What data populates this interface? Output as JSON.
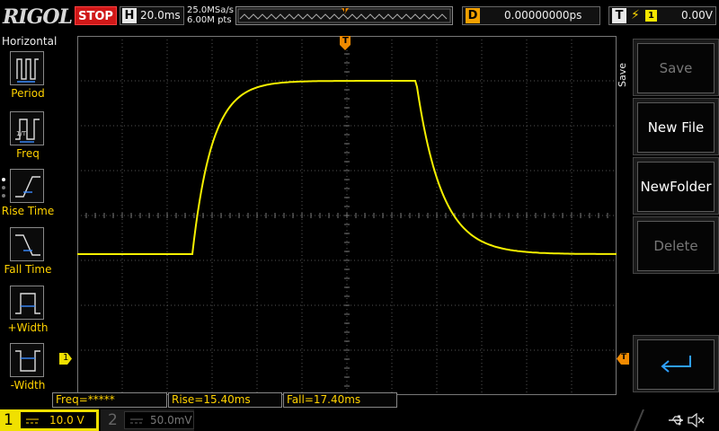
{
  "topbar": {
    "logo": "RIGOL",
    "run_state": "STOP",
    "horizontal": {
      "label": "H",
      "value": "20.0ms"
    },
    "sample_rate": "25.0MSa/s",
    "memory_depth": "6.00M pts",
    "trigger_position_marker": "T",
    "delay": {
      "label": "D",
      "value": "0.00000000ps"
    },
    "trigger": {
      "label": "T",
      "edge": "rising-edge-icon",
      "source": "1",
      "level": "0.00V"
    }
  },
  "left_menu": {
    "title": "Horizontal",
    "items": [
      {
        "label": "Period",
        "icon": "period-icon"
      },
      {
        "label": "Freq",
        "icon": "freq-icon"
      },
      {
        "label": "Rise Time",
        "icon": "rise-time-icon"
      },
      {
        "label": "Fall Time",
        "icon": "fall-time-icon"
      },
      {
        "label": "+Width",
        "icon": "positive-width-icon"
      },
      {
        "label": "-Width",
        "icon": "negative-width-icon"
      }
    ]
  },
  "softkeys": {
    "side_label": "Save",
    "keys": [
      {
        "label": "Save",
        "enabled": false
      },
      {
        "label": "New File",
        "enabled": true
      },
      {
        "label": "NewFolder",
        "enabled": true
      },
      {
        "label": "Delete",
        "enabled": false
      },
      {
        "label": "",
        "icon": "enter-icon",
        "enabled": true
      }
    ]
  },
  "measurements": {
    "freq": "Freq=*****",
    "rise": "Rise=15.40ms",
    "fall": "Fall=17.40ms"
  },
  "channels": {
    "ch1": {
      "number": "1",
      "scale": "10.0 V",
      "coupling_icon": "dc-coupling-icon",
      "color": "#f0e000"
    },
    "ch2": {
      "number": "2",
      "scale": "50.0mV",
      "coupling_icon": "dc-coupling-icon",
      "color": "#555555"
    }
  },
  "markers": {
    "trigger_top": "T",
    "ch1_offset": "1",
    "trigger_level": "T"
  },
  "colors": {
    "trace": "#f5f000",
    "stop": "#d01818",
    "accent": "#ffd200",
    "trigger_marker": "#f08a00"
  },
  "status_icons": [
    "usb-icon",
    "speaker-muted-icon"
  ]
}
